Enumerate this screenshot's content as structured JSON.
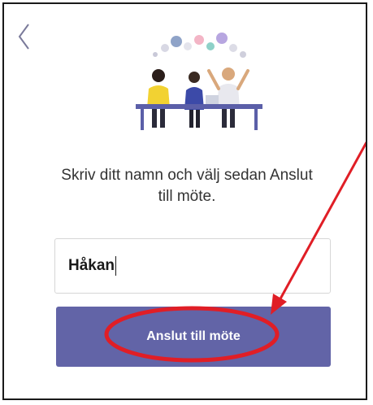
{
  "screen": {
    "back_icon": "chevron-left-icon",
    "illustration": "people-at-table-illustration"
  },
  "instruction": {
    "line1": "Skriv ditt namn och välj sedan Anslut",
    "line2": "till möte."
  },
  "name_field": {
    "value": "Håkan"
  },
  "join_button": {
    "label": "Anslut till möte"
  },
  "colors": {
    "accent": "#6264a7",
    "annotation": "#e01e26"
  }
}
